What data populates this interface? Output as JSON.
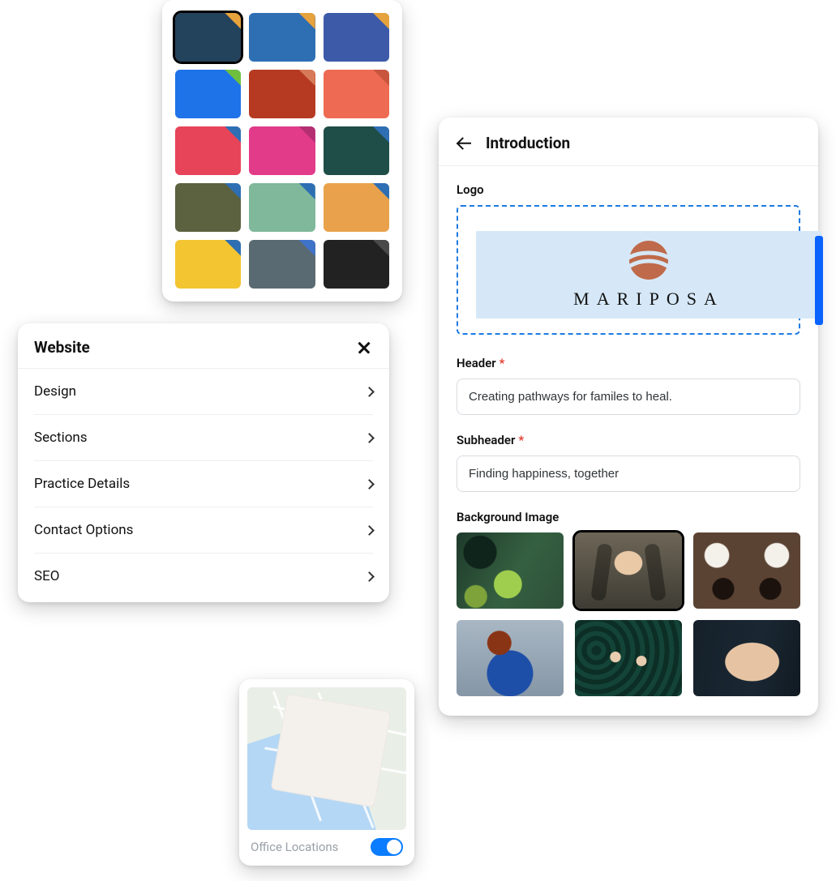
{
  "palette": {
    "swatches": [
      {
        "color": "#23425c",
        "accent": "#e6a23c",
        "selected": true
      },
      {
        "color": "#2e6fb4",
        "accent": "#e6a23c",
        "selected": false
      },
      {
        "color": "#3d5aa9",
        "accent": "#e6a23c",
        "selected": false
      },
      {
        "color": "#1f73e8",
        "accent": "#6fbf3f",
        "selected": false
      },
      {
        "color": "#b63a21",
        "accent": "#d67a5a",
        "selected": false
      },
      {
        "color": "#ee6a52",
        "accent": "#c8563f",
        "selected": false
      },
      {
        "color": "#e84459",
        "accent": "#2e6fb4",
        "selected": false
      },
      {
        "color": "#e13b8a",
        "accent": "#b42f72",
        "selected": false
      },
      {
        "color": "#1f4d47",
        "accent": "#2e6fb4",
        "selected": false
      },
      {
        "color": "#5c6140",
        "accent": "#2e6fb4",
        "selected": false
      },
      {
        "color": "#7fb89a",
        "accent": "#2e6fb4",
        "selected": false
      },
      {
        "color": "#e9a24b",
        "accent": "#2e6fb4",
        "selected": false
      },
      {
        "color": "#f2c531",
        "accent": "#2e6fb4",
        "selected": false
      },
      {
        "color": "#5a6a72",
        "accent": "#3f72c9",
        "selected": false
      },
      {
        "color": "#222222",
        "accent": "#4a4a4a",
        "selected": false
      }
    ]
  },
  "website": {
    "title": "Website",
    "items": [
      {
        "label": "Design"
      },
      {
        "label": "Sections"
      },
      {
        "label": "Practice Details"
      },
      {
        "label": "Contact Options"
      },
      {
        "label": "SEO"
      }
    ]
  },
  "map": {
    "footer_label": "Office Locations",
    "toggle_on": true
  },
  "intro": {
    "title": "Introduction",
    "logo_label": "Logo",
    "logo_wordmark": "MARIPOSA",
    "header_label": "Header",
    "header_value": "Creating pathways for familes to heal.",
    "subheader_label": "Subheader",
    "subheader_value": "Finding happiness, together",
    "bg_label": "Background Image",
    "thumbs": [
      {
        "name": "greens-kiwi",
        "selected": false
      },
      {
        "name": "family-walk",
        "selected": true
      },
      {
        "name": "coffee-table",
        "selected": false
      },
      {
        "name": "person-laughing",
        "selected": false
      },
      {
        "name": "green-tubes",
        "selected": false
      },
      {
        "name": "holding-hands",
        "selected": false
      }
    ]
  }
}
